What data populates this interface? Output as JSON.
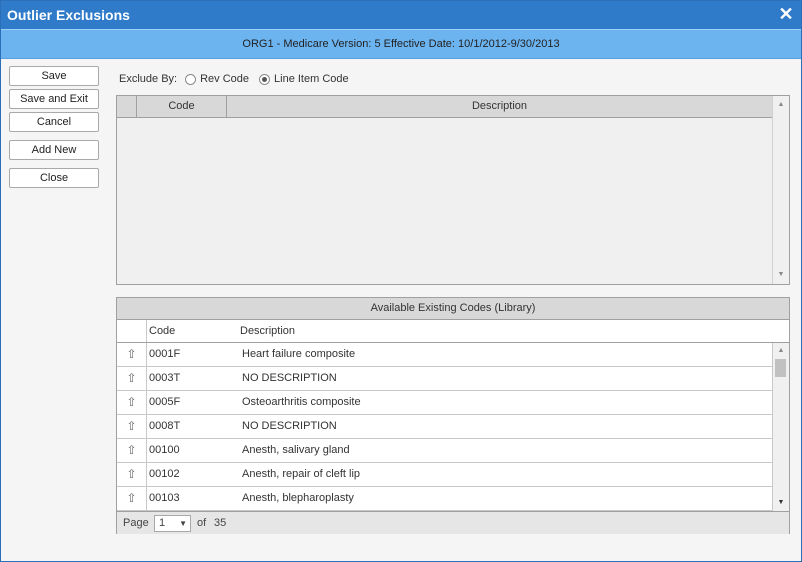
{
  "window": {
    "title": "Outlier Exclusions"
  },
  "subheader": "ORG1 - Medicare Version: 5 Effective Date: 10/1/2012-9/30/2013",
  "buttons": {
    "save": "Save",
    "save_exit": "Save and Exit",
    "cancel": "Cancel",
    "add_new": "Add New",
    "close": "Close"
  },
  "exclude": {
    "label": "Exclude By:",
    "options": [
      "Rev Code",
      "Line Item Code"
    ],
    "selected": "Line Item Code"
  },
  "exclusions_grid": {
    "columns": [
      "Code",
      "Description"
    ]
  },
  "library": {
    "title": "Available Existing Codes (Library)",
    "columns": [
      "Code",
      "Description"
    ],
    "rows": [
      {
        "code": "0001F",
        "description": "Heart failure composite"
      },
      {
        "code": "0003T",
        "description": "NO DESCRIPTION"
      },
      {
        "code": "0005F",
        "description": "Osteoarthritis composite"
      },
      {
        "code": "0008T",
        "description": "NO DESCRIPTION"
      },
      {
        "code": "00100",
        "description": "Anesth, salivary gland"
      },
      {
        "code": "00102",
        "description": "Anesth, repair of cleft lip"
      },
      {
        "code": "00103",
        "description": "Anesth, blepharoplasty"
      }
    ]
  },
  "pager": {
    "page_label": "Page",
    "current_page": "1",
    "of_label": "of",
    "total_pages": "35"
  },
  "icons": {
    "close": "close-icon",
    "move_up": "move-up-icon",
    "scroll_up": "scroll-up-arrow-icon",
    "scroll_down": "scroll-down-arrow-icon",
    "dropdown": "chevron-down-icon"
  },
  "colors": {
    "titlebar": "#2f7bc9",
    "subheader": "#6cb4f0",
    "header_gray": "#d8d8d8"
  }
}
